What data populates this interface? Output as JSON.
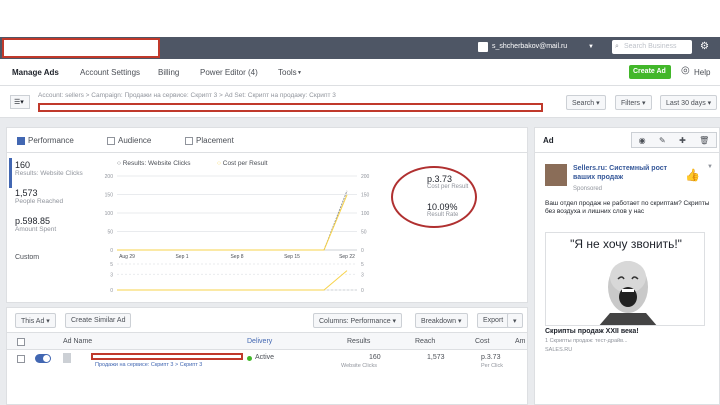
{
  "header": {
    "email": "s_shcherbakov@mail.ru",
    "search_placeholder": "Search Business"
  },
  "nav": {
    "items": [
      "Manage Ads",
      "Account Settings",
      "Billing",
      "Power Editor (4)",
      "Tools"
    ],
    "create_ad": "Create Ad",
    "help": "Help"
  },
  "breadcrumb": {
    "text": "Account: sellers  >  Campaign: Продажи на сервисе: Скрипт 3  >  Ad Set: Скрипт на продажу: Скрипт 3",
    "buttons": [
      "Search",
      "Filters",
      "Last 30 days"
    ]
  },
  "tabs": [
    "Performance",
    "Audience",
    "Placement"
  ],
  "metrics": [
    {
      "value": "160",
      "label": "Results: Website Clicks"
    },
    {
      "value": "1,573",
      "label": "People Reached"
    },
    {
      "value": "р.598.85",
      "label": "Amount Spent"
    }
  ],
  "custom_label": "Custom",
  "legend": [
    "Results: Website Clicks",
    "Cost per Result"
  ],
  "summary": {
    "cost": "р.3.73",
    "cost_label": "Cost per Result",
    "ctr": "10.09%",
    "ctr_label": "Result Rate"
  },
  "table": {
    "buttons": [
      "This Ad",
      "Create Similar Ad",
      "Columns: Performance",
      "Breakdown",
      "Export"
    ],
    "headers": [
      "Ad Name",
      "Delivery",
      "Results",
      "Reach",
      "Cost",
      "Am"
    ],
    "row": {
      "delivery": "Active",
      "results": "160",
      "results_sub": "Website Clicks",
      "reach": "1,573",
      "cost": "р.3.73",
      "cost_sub": "Per Click",
      "sub": "Продажи на сервисе: Скрипт 3  >  Скрипт 3"
    }
  },
  "ad_preview": {
    "title": "Ad",
    "page": "Sellers.ru: Системный рост ваших продаж",
    "sponsored": "Sponsored",
    "text": "Ваш отдел продаж не работает по скриптам? Скрипты без воздуха и лишних слов у нас",
    "quote": "\"Я не хочу звонить!\"",
    "headline": "Скрипты продаж XXII века!",
    "sub": "1 Скрипты продаж: тест-драйв...",
    "domain": "SALES.RU"
  },
  "chart_data": {
    "type": "line",
    "x_ticks": [
      "Aug 29",
      "Sep 1",
      "Sep 8",
      "Sep 15",
      "Sep 22"
    ],
    "y_left_ticks": [
      0,
      50,
      100,
      150,
      200
    ],
    "y_right_ticks": [
      0,
      50,
      100,
      150,
      200
    ],
    "series": [
      {
        "name": "Results: Website Clicks",
        "x": [
          0,
          0.9,
          1.0
        ],
        "values": [
          0,
          0,
          160
        ],
        "color": "#90949c"
      },
      {
        "name": "Cost per Result",
        "x": [
          0,
          0.9,
          1.0
        ],
        "values": [
          0,
          0,
          3.73
        ],
        "color": "#f7d34b"
      }
    ],
    "sub_y_ticks": [
      0,
      3,
      5
    ],
    "ylim": [
      0,
      200
    ]
  }
}
